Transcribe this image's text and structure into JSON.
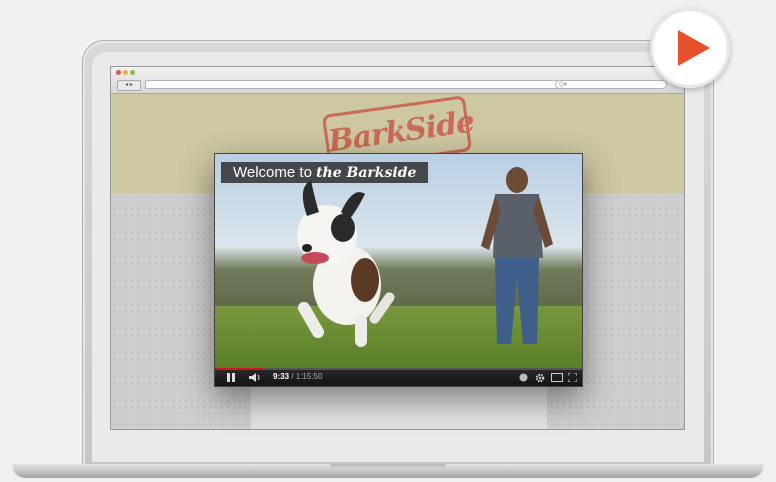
{
  "browser": {
    "nav_buttons": "◂ ▸",
    "url": "",
    "reload_icon": "reload-icon",
    "search_placeholder": "Q▾"
  },
  "site": {
    "logo_text": "BarkSide"
  },
  "player": {
    "title_prefix": "Welcome to ",
    "title_script": "the Barkside",
    "time_current": "9:33",
    "time_total": "/ 1:15:50",
    "progress_fraction": 0.13,
    "colors": {
      "progress": "#cc181e",
      "bar": "#1c1c1c"
    }
  },
  "icons": {
    "play_badge": "play-icon",
    "pause": "pause-icon",
    "volume": "volume-icon",
    "captions": "captions-icon",
    "settings": "gear-icon",
    "theater": "theater-mode-icon",
    "fullscreen": "fullscreen-icon"
  },
  "brand_colors": {
    "play_accent": "#e8502c",
    "logo": "#c96b56",
    "header": "#cdc7a2"
  }
}
